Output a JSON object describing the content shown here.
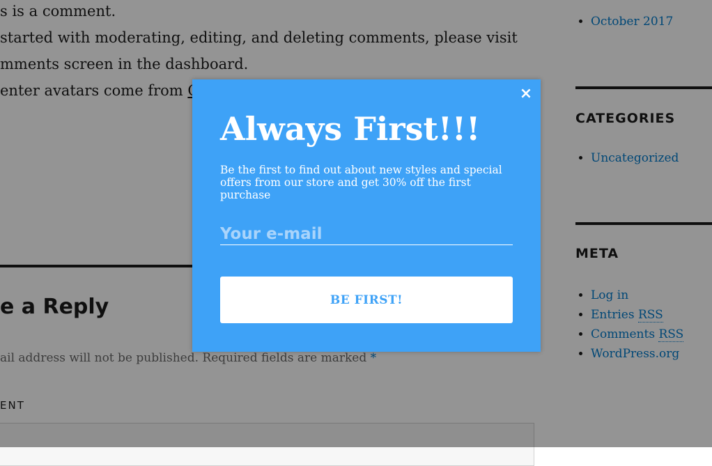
{
  "comment": {
    "line1": "s is a comment.",
    "line2": "started with moderating, editing, and deleting comments, please visit",
    "line3": "mments screen in the dashboard.",
    "line4_prefix": "enter avatars come from ",
    "line4_link": "G"
  },
  "reply": {
    "title": "e a Reply",
    "notes": "ail address will not be published. Required fields are marked ",
    "required_mark": "*",
    "comment_label": "ENT"
  },
  "sidebar": {
    "archives": [
      "October 2017"
    ],
    "categories_title": "CATEGORIES",
    "categories": [
      "Uncategorized"
    ],
    "meta_title": "META",
    "meta_links": {
      "login": "Log in",
      "entries": "Entries",
      "comments": "Comments",
      "rss": "RSS",
      "wordpress": "WordPress.org"
    }
  },
  "popup": {
    "title": "Always First!!!",
    "description": "Be the first to find out about new styles and special offers from our store and get 30% off the first purchase",
    "email_placeholder": "Your e-mail",
    "email_value": "",
    "submit_label": "BE FIRST!",
    "close_glyph": "×",
    "bg_color": "#3ea2f7",
    "close_icon": "close-icon"
  }
}
